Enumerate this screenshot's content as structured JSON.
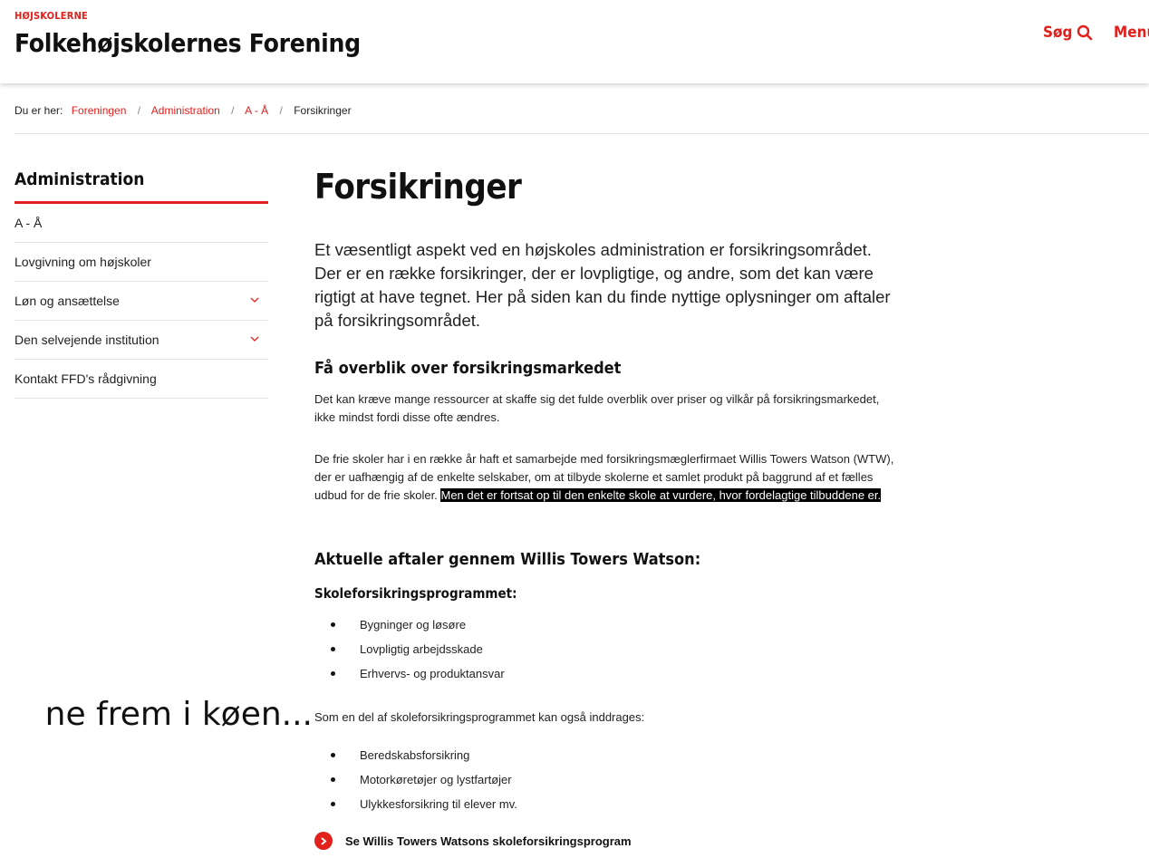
{
  "header": {
    "brand_small": "HØJSKOLERNE",
    "brand_title": "Folkehøjskolernes Forening",
    "search_label": "Søg",
    "search_icon": "search-icon",
    "menu_label": "Menu"
  },
  "breadcrumb": {
    "prefix": "Du er her:",
    "items": [
      "Foreningen",
      "Administration",
      "A - Å",
      "Forsikringer"
    ],
    "separator": "/"
  },
  "sidebar": {
    "title": "Administration",
    "items": [
      {
        "label": "A - Å",
        "expandable": false
      },
      {
        "label": "Lovgivning om højskoler",
        "expandable": false
      },
      {
        "label": "Løn og ansættelse",
        "expandable": true
      },
      {
        "label": "Den selvejende institution",
        "expandable": true
      },
      {
        "label": "Kontakt FFD's rådgivning",
        "expandable": false
      }
    ]
  },
  "main": {
    "title": "Forsikringer",
    "intro": "Et væsentligt aspekt ved en højskoles administration er forsikringsområdet. Der er en række forsikringer, der er lovpligtige, og andre, som det kan være rigtigt at have tegnet. Her på siden kan du finde nyttige oplysninger om aftaler på forsikringsområdet.",
    "section1_heading": "Få overblik over forsikringsmarkedet",
    "section1_p1": "Det kan kræve mange ressourcer at skaffe sig det fulde overblik over priser og vilkår på forsikringsmarkedet, ikke mindst fordi disse ofte ændres.",
    "section1_p2_plain": "De frie skoler har i en række år haft et samarbejde med forsikringsmæglerfirmaet Willis Towers Watson (WTW), der er uafhængig af de enkelte selskaber, om at tilbyde skolerne et samlet produkt på baggrund af et fælles udbud for de frie skoler. ",
    "section1_p2_highlight": "Men det er fortsat op til den enkelte skole at vurdere, hvor fordelagtige tilbuddene er.",
    "section2_heading": "Aktuelle aftaler gennem Willis Towers Watson:",
    "section2_subheading": "Skoleforsikringsprogrammet:",
    "list1": [
      "Bygninger og løsøre",
      "Lovpligtig arbejdsskade",
      "Erhvervs- og produktansvar"
    ],
    "list_intro": "Som en del af skoleforsikringsprogrammet kan også inddrages:",
    "list2": [
      "Beredskabsforsikring",
      "Motorkøretøjer og lystfartøjer",
      "Ulykkesforsikring til elever mv."
    ],
    "cta_label": "Se Willis Towers Watsons skoleforsikringsprogram",
    "cta_icon": "arrow-right-circle-icon"
  },
  "overlay": {
    "caption": "ne frem i køen..."
  },
  "colors": {
    "accent": "#e2201c",
    "text": "#111111",
    "divider": "#e3e3e3"
  }
}
